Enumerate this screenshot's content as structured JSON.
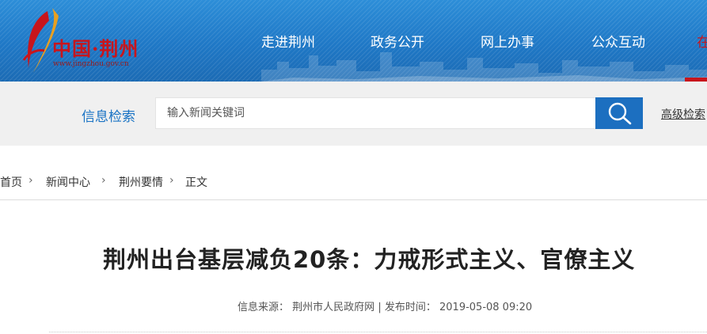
{
  "header": {
    "logo": {
      "name": "中国·荆州",
      "url": "www.jingzhou.gov.cn"
    },
    "nav": [
      {
        "label": "走进荆州"
      },
      {
        "label": "政务公开"
      },
      {
        "label": "网上办事"
      },
      {
        "label": "公众互动"
      }
    ],
    "nav_overflow": "在"
  },
  "search": {
    "label": "信息检索",
    "placeholder": "输入新闻关键词",
    "button_icon": "search-icon",
    "advanced_label": "高级检索"
  },
  "breadcrumb": [
    "首页",
    "新闻中心",
    "荆州要情",
    "正文"
  ],
  "article": {
    "title": "荆州出台基层减负20条：力戒形式主义、官僚主义",
    "source_label": "信息来源：",
    "source": "荆州市人民政府网",
    "divider": "|",
    "time_label": "发布时间：",
    "time": "2019-05-08 09:20"
  },
  "colors": {
    "banner_blue": "#1f78c6",
    "brand_red": "#c8151c",
    "search_button": "#1c6fc0",
    "label_blue": "#1a73c4"
  }
}
